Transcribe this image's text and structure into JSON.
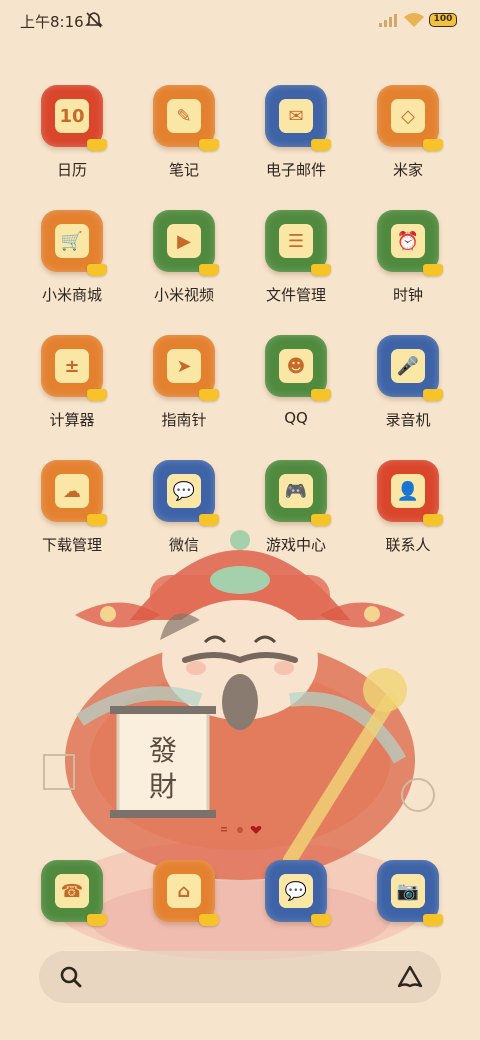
{
  "status_bar": {
    "time": "上午8:16",
    "battery": "100",
    "icons": [
      "mute-icon",
      "signal-icon",
      "wifi-icon",
      "battery-icon"
    ]
  },
  "apps": [
    {
      "label": "日历",
      "icon": "calendar-icon",
      "color": "#d9462c",
      "glyph": "10"
    },
    {
      "label": "笔记",
      "icon": "notes-icon",
      "color": "#e3812e",
      "glyph": "✎"
    },
    {
      "label": "电子邮件",
      "icon": "email-icon",
      "color": "#3e63a6",
      "glyph": "✉"
    },
    {
      "label": "米家",
      "icon": "mijia-icon",
      "color": "#e3812e",
      "glyph": "◇"
    },
    {
      "label": "小米商城",
      "icon": "shop-cart-icon",
      "color": "#e3812e",
      "glyph": "🛒"
    },
    {
      "label": "小米视频",
      "icon": "video-icon",
      "color": "#4f8a3e",
      "glyph": "▶"
    },
    {
      "label": "文件管理",
      "icon": "file-manager-icon",
      "color": "#4f8a3e",
      "glyph": "☰"
    },
    {
      "label": "时钟",
      "icon": "clock-icon",
      "color": "#4f8a3e",
      "glyph": "⏰"
    },
    {
      "label": "计算器",
      "icon": "calculator-icon",
      "color": "#e3812e",
      "glyph": "±"
    },
    {
      "label": "指南针",
      "icon": "compass-icon",
      "color": "#e3812e",
      "glyph": "➤"
    },
    {
      "label": "QQ",
      "icon": "qq-icon",
      "color": "#4f8a3e",
      "glyph": "☻"
    },
    {
      "label": "录音机",
      "icon": "recorder-icon",
      "color": "#3e63a6",
      "glyph": "🎤"
    },
    {
      "label": "下载管理",
      "icon": "download-icon",
      "color": "#e3812e",
      "glyph": "☁"
    },
    {
      "label": "微信",
      "icon": "wechat-icon",
      "color": "#3e63a6",
      "glyph": "💬"
    },
    {
      "label": "游戏中心",
      "icon": "game-center-icon",
      "color": "#4f8a3e",
      "glyph": "🎮"
    },
    {
      "label": "联系人",
      "icon": "contacts-icon",
      "color": "#d9462c",
      "glyph": "👤"
    }
  ],
  "dock": [
    {
      "name": "phone-button",
      "icon": "phone-icon",
      "color": "#4f8a3e",
      "glyph": "☎"
    },
    {
      "name": "home-button",
      "icon": "home-icon",
      "color": "#e3812e",
      "glyph": "⌂"
    },
    {
      "name": "messages-button",
      "icon": "messages-icon",
      "color": "#3e63a6",
      "glyph": "💬"
    },
    {
      "name": "camera-button",
      "icon": "camera-icon",
      "color": "#3e63a6",
      "glyph": "📷"
    }
  ],
  "page_indicator": {
    "current": 2,
    "total": 2
  },
  "search": {
    "icon": "search-icon",
    "assistant_icon": "assistant-icon"
  }
}
